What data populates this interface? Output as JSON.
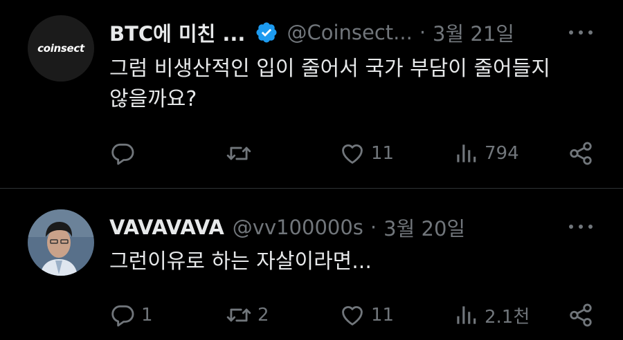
{
  "tweets": [
    {
      "avatar_text": "coinsect",
      "name": "BTC에 미친 ...",
      "verified": true,
      "handle": "@Coinsect...",
      "separator": "·",
      "date": "3월 21일",
      "text_line1": "그럼 비생산적인 입이 줄어서 국가 부담이 줄어들지",
      "text_line2": "않을까요?",
      "reply_count": "",
      "retweet_count": "",
      "like_count": "11",
      "view_count": "794"
    },
    {
      "name": "VAVAVAVA",
      "handle": "@vv100000s",
      "separator": "·",
      "date": "3월 20일",
      "text_line1": "그런이유로 하는 자살이라면...",
      "reply_count": "1",
      "retweet_count": "2",
      "like_count": "11",
      "view_count": "2.1천"
    }
  ],
  "icons": {
    "reply": "reply-icon",
    "retweet": "retweet-icon",
    "like": "heart-icon",
    "views": "views-icon",
    "share": "share-icon",
    "more": "more-icon",
    "verified": "verified-badge-icon"
  },
  "colors": {
    "background": "#000000",
    "text": "#e7e9ea",
    "muted": "#71767b",
    "verified": "#1d9bf0",
    "divider": "#2f3336"
  }
}
